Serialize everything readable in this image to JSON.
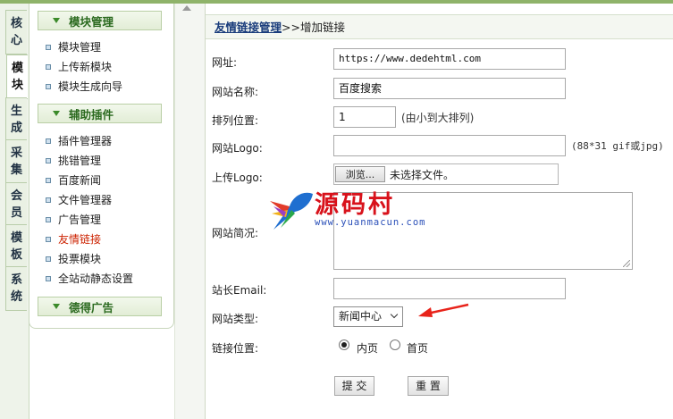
{
  "tabs": [
    {
      "label": "核心"
    },
    {
      "label": "模块",
      "active": true
    },
    {
      "label": "生成"
    },
    {
      "label": "采集"
    },
    {
      "label": "会员"
    },
    {
      "label": "模板"
    },
    {
      "label": "系统"
    }
  ],
  "sidebar": {
    "sections": [
      {
        "title": "模块管理",
        "items": [
          "模块管理",
          "上传新模块",
          "模块生成向导"
        ]
      },
      {
        "title": "辅助插件",
        "items": [
          "插件管理器",
          "挑错管理",
          "百度新闻",
          "文件管理器",
          "广告管理",
          "友情链接",
          "投票模块",
          "全站动静态设置"
        ]
      },
      {
        "title": "德得广告",
        "items": []
      }
    ],
    "current_item": "友情链接"
  },
  "breadcrumb": {
    "link": "友情链接管理",
    "sep": ">>",
    "current": "增加链接"
  },
  "form": {
    "url": {
      "label": "网址:",
      "value": "https://www.dedehtml.com"
    },
    "name": {
      "label": "网站名称:",
      "value": "百度搜索"
    },
    "order": {
      "label": "排列位置:",
      "value": "1",
      "hint": "(由小到大排列)"
    },
    "logo": {
      "label": "网站Logo:",
      "value": "",
      "hint": "(88*31 gif或jpg)"
    },
    "upload_logo": {
      "label": "上传Logo:",
      "button": "浏览...",
      "status": "未选择文件。"
    },
    "desc": {
      "label": "网站简况:",
      "value": ""
    },
    "email": {
      "label": "站长Email:",
      "value": ""
    },
    "type": {
      "label": "网站类型:",
      "selected": "新闻中心"
    },
    "position": {
      "label": "链接位置:",
      "options": [
        "内页",
        "首页"
      ],
      "selected": "内页"
    },
    "submit": "提 交",
    "reset": "重 置"
  },
  "watermark": {
    "title": "源码村",
    "url": "www.yuanmacun.com"
  },
  "colors": {
    "accent_green": "#3b8a2a",
    "current_red": "#cc2200",
    "link_blue": "#1a3d7c",
    "arrow_red": "#e8231a"
  }
}
